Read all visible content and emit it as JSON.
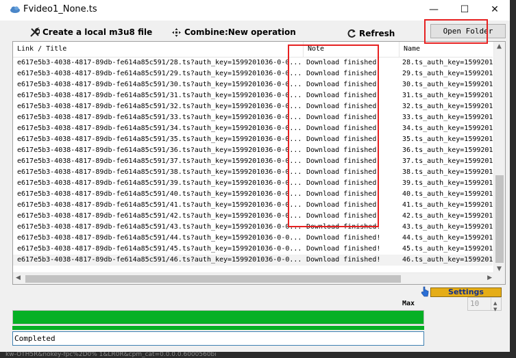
{
  "window": {
    "title": "Fvideo1_None.ts",
    "minimize_glyph": "—",
    "maximize_glyph": "☐",
    "close_glyph": "✕"
  },
  "toolbar": {
    "create_label": "Create a local m3u8 file",
    "combine_label": "Combine:New operation",
    "refresh_label": "Refresh",
    "open_folder_label": "Open Folder"
  },
  "icons": {
    "create": "wrench-icon",
    "combine": "arrows-icon",
    "refresh": "refresh-icon",
    "settings": "pointer-icon"
  },
  "list": {
    "columns": {
      "link": "Link / Title",
      "note": "Note",
      "name": "Name"
    },
    "rows": [
      {
        "link": "e617e5b3-4038-4817-89db-fe614a85c591/28.ts?auth_key=1599201036-0-0...",
        "note": "Download finished!",
        "name": "28.ts_auth_key=1599201"
      },
      {
        "link": "e617e5b3-4038-4817-89db-fe614a85c591/29.ts?auth_key=1599201036-0-0...",
        "note": "Download finished!",
        "name": "29.ts_auth_key=1599201"
      },
      {
        "link": "e617e5b3-4038-4817-89db-fe614a85c591/30.ts?auth_key=1599201036-0-0...",
        "note": "Download finished!",
        "name": "30.ts_auth_key=1599201"
      },
      {
        "link": "e617e5b3-4038-4817-89db-fe614a85c591/31.ts?auth_key=1599201036-0-0...",
        "note": "Download finished!",
        "name": "31.ts_auth_key=1599201"
      },
      {
        "link": "e617e5b3-4038-4817-89db-fe614a85c591/32.ts?auth_key=1599201036-0-0...",
        "note": "Download finished!",
        "name": "32.ts_auth_key=1599201"
      },
      {
        "link": "e617e5b3-4038-4817-89db-fe614a85c591/33.ts?auth_key=1599201036-0-0...",
        "note": "Download finished!",
        "name": "33.ts_auth_key=1599201"
      },
      {
        "link": "e617e5b3-4038-4817-89db-fe614a85c591/34.ts?auth_key=1599201036-0-0...",
        "note": "Download finished!",
        "name": "34.ts_auth_key=1599201"
      },
      {
        "link": "e617e5b3-4038-4817-89db-fe614a85c591/35.ts?auth_key=1599201036-0-0...",
        "note": "Download finished!",
        "name": "35.ts_auth_key=1599201"
      },
      {
        "link": "e617e5b3-4038-4817-89db-fe614a85c591/36.ts?auth_key=1599201036-0-0...",
        "note": "Download finished!",
        "name": "36.ts_auth_key=1599201"
      },
      {
        "link": "e617e5b3-4038-4817-89db-fe614a85c591/37.ts?auth_key=1599201036-0-0...",
        "note": "Download finished!",
        "name": "37.ts_auth_key=1599201"
      },
      {
        "link": "e617e5b3-4038-4817-89db-fe614a85c591/38.ts?auth_key=1599201036-0-0...",
        "note": "Download finished!",
        "name": "38.ts_auth_key=1599201"
      },
      {
        "link": "e617e5b3-4038-4817-89db-fe614a85c591/39.ts?auth_key=1599201036-0-0...",
        "note": "Download finished!",
        "name": "39.ts_auth_key=1599201"
      },
      {
        "link": "e617e5b3-4038-4817-89db-fe614a85c591/40.ts?auth_key=1599201036-0-0...",
        "note": "Download finished!",
        "name": "40.ts_auth_key=1599201"
      },
      {
        "link": "e617e5b3-4038-4817-89db-fe614a85c591/41.ts?auth_key=1599201036-0-0...",
        "note": "Download finished!",
        "name": "41.ts_auth_key=1599201"
      },
      {
        "link": "e617e5b3-4038-4817-89db-fe614a85c591/42.ts?auth_key=1599201036-0-0...",
        "note": "Download finished!",
        "name": "42.ts_auth_key=1599201"
      },
      {
        "link": "e617e5b3-4038-4817-89db-fe614a85c591/43.ts?auth_key=1599201036-0-0...",
        "note": "Download finished!",
        "name": "43.ts_auth_key=1599201"
      },
      {
        "link": "e617e5b3-4038-4817-89db-fe614a85c591/44.ts?auth_key=1599201036-0-0...",
        "note": "Download finished!",
        "name": "44.ts_auth_key=1599201"
      },
      {
        "link": "e617e5b3-4038-4817-89db-fe614a85c591/45.ts?auth_key=1599201036-0-0...",
        "note": "Download finished!",
        "name": "45.ts_auth_key=1599201"
      },
      {
        "link": "e617e5b3-4038-4817-89db-fe614a85c591/46.ts?auth_key=1599201036-0-0...",
        "note": "Download finished!",
        "name": "46.ts_auth_key=1599201"
      }
    ],
    "selected_row_index": 18
  },
  "settings": {
    "label": "Settings"
  },
  "max": {
    "label": "Max",
    "value": "10"
  },
  "progress": {
    "value_percent": 100,
    "secondary_percent": 100,
    "color": "#06b025"
  },
  "status": {
    "text": "Completed"
  },
  "background_strip": "kw-OTH5R&nokey-fpc%2D0% 1&LR0R&cpm_cat=0.0.0.0.6000560bi",
  "colors": {
    "highlight_box": "#e62020",
    "settings_bg": "#e5ad17",
    "settings_text": "#14308a"
  }
}
